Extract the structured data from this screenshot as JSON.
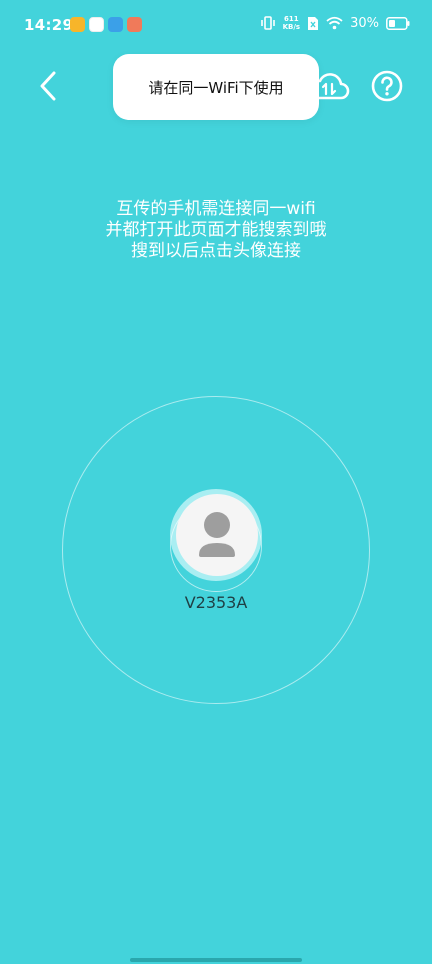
{
  "status_bar": {
    "time": "14:29",
    "net_speed_value": "611",
    "net_speed_unit": "KB/s",
    "battery": "30%"
  },
  "toast": {
    "text": "请在同一WiFi下使用"
  },
  "hint": {
    "line1": "互传的手机需连接同一wifi",
    "line2": "并都打开此页面才能搜索到哦",
    "line3": "搜到以后点击头像连接"
  },
  "device": {
    "name": "V2353A"
  },
  "colors": {
    "background": "#43d3db",
    "toast_bg": "#ffffff",
    "avatar_bg": "#f5f5f5",
    "avatar_glyph": "#9e9e9e"
  },
  "icons": [
    "back-icon",
    "cloud-transfer-icon",
    "help-icon",
    "avatar-person-icon"
  ]
}
